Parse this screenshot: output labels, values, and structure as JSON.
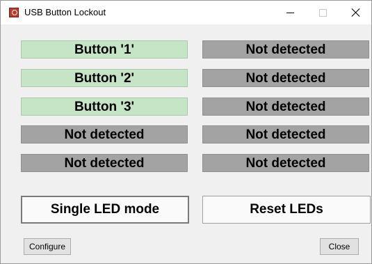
{
  "window": {
    "title": "USB Button Lockout",
    "icon": "app-logo-icon"
  },
  "caption_buttons": {
    "minimize": "minimize-icon",
    "maximize": "maximize-icon",
    "close": "close-icon"
  },
  "slots": {
    "left": [
      {
        "label": "Button '1'",
        "state": "detected"
      },
      {
        "label": "Button '2'",
        "state": "detected"
      },
      {
        "label": "Button '3'",
        "state": "detected"
      },
      {
        "label": "Not detected",
        "state": "undetected"
      },
      {
        "label": "Not detected",
        "state": "undetected"
      }
    ],
    "right": [
      {
        "label": "Not detected",
        "state": "undetected"
      },
      {
        "label": "Not detected",
        "state": "undetected"
      },
      {
        "label": "Not detected",
        "state": "undetected"
      },
      {
        "label": "Not detected",
        "state": "undetected"
      },
      {
        "label": "Not detected",
        "state": "undetected"
      }
    ]
  },
  "actions": {
    "single_led_mode": "Single LED mode",
    "reset_leds": "Reset LEDs",
    "configure": "Configure",
    "close": "Close"
  },
  "colors": {
    "detected": "#c6e4c6",
    "undetected": "#a3a3a3",
    "window_bg": "#f0f0f0"
  }
}
